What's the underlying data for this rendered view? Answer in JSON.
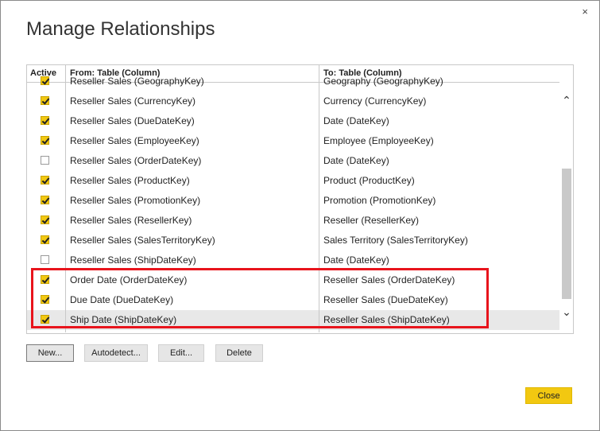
{
  "dialog": {
    "title": "Manage Relationships",
    "close_glyph": "×"
  },
  "grid": {
    "headers": {
      "active": "Active",
      "from": "From: Table (Column)",
      "to": "To: Table (Column)"
    },
    "partial_row": {
      "from": "Reseller Sales (GeographyKey)",
      "to": "Geography (GeographyKey)"
    },
    "rows": [
      {
        "active": true,
        "from": "Reseller Sales (CurrencyKey)",
        "to": "Currency (CurrencyKey)"
      },
      {
        "active": true,
        "from": "Reseller Sales (DueDateKey)",
        "to": "Date (DateKey)"
      },
      {
        "active": true,
        "from": "Reseller Sales (EmployeeKey)",
        "to": "Employee (EmployeeKey)"
      },
      {
        "active": false,
        "from": "Reseller Sales (OrderDateKey)",
        "to": "Date (DateKey)"
      },
      {
        "active": true,
        "from": "Reseller Sales (ProductKey)",
        "to": "Product (ProductKey)"
      },
      {
        "active": true,
        "from": "Reseller Sales (PromotionKey)",
        "to": "Promotion (PromotionKey)"
      },
      {
        "active": true,
        "from": "Reseller Sales (ResellerKey)",
        "to": "Reseller (ResellerKey)"
      },
      {
        "active": true,
        "from": "Reseller Sales (SalesTerritoryKey)",
        "to": "Sales Territory (SalesTerritoryKey)"
      },
      {
        "active": false,
        "from": "Reseller Sales (ShipDateKey)",
        "to": "Date (DateKey)"
      },
      {
        "active": true,
        "from": "Order Date (OrderDateKey)",
        "to": "Reseller Sales (OrderDateKey)"
      },
      {
        "active": true,
        "from": "Due Date (DueDateKey)",
        "to": "Reseller Sales (DueDateKey)"
      },
      {
        "active": true,
        "from": "Ship Date (ShipDateKey)",
        "to": "Reseller Sales (ShipDateKey)",
        "selected": true
      }
    ],
    "scroll_up_glyph": "⌃",
    "scroll_down_glyph": "⌄"
  },
  "buttons": {
    "new": "New...",
    "autodetect": "Autodetect...",
    "edit": "Edit...",
    "delete": "Delete",
    "close": "Close"
  },
  "colors": {
    "accent": "#f2c811",
    "highlight": "#e8141c"
  },
  "icons": {
    "checkbox": "checkbox-icon",
    "close": "close-icon",
    "scroll_up": "chevron-up-icon",
    "scroll_down": "chevron-down-icon"
  }
}
